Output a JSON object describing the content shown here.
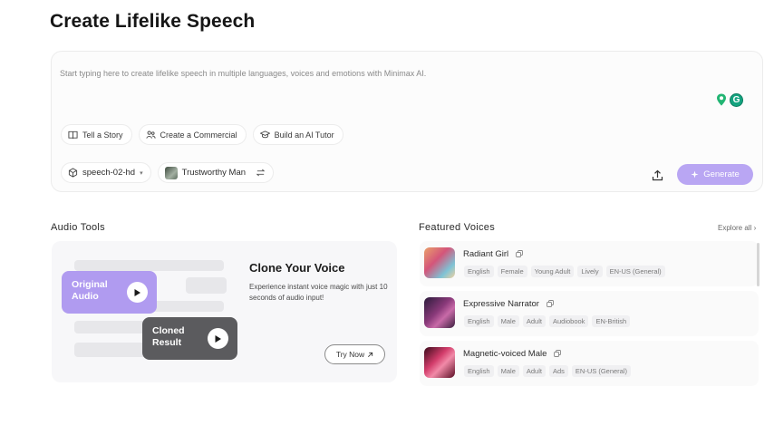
{
  "page": {
    "title": "Create Lifelike Speech"
  },
  "editor": {
    "placeholder": "Start typing here to create lifelike speech in multiple languages, voices and emotions with Minimax AI.",
    "chips": [
      {
        "label": "Tell a Story",
        "icon": "book-icon"
      },
      {
        "label": "Create a Commercial",
        "icon": "people-icon"
      },
      {
        "label": "Build an AI Tutor",
        "icon": "graduation-cap-icon"
      }
    ],
    "model": {
      "label": "speech-02-hd",
      "icon": "cube-icon"
    },
    "voice": {
      "label": "Trustworthy Man"
    },
    "generate_label": "Generate"
  },
  "audio_tools": {
    "title": "Audio Tools",
    "original_label": "Original Audio",
    "cloned_label": "Cloned Result",
    "clone_title": "Clone Your Voice",
    "clone_desc": "Experience instant voice magic with just 10 seconds of audio input!",
    "try_label": "Try Now"
  },
  "featured": {
    "title": "Featured Voices",
    "explore_label": "Explore all",
    "voices": [
      {
        "name": "Radiant Girl",
        "tags": [
          "English",
          "Female",
          "Young Adult",
          "Lively",
          "EN-US (General)"
        ]
      },
      {
        "name": "Expressive Narrator",
        "tags": [
          "English",
          "Male",
          "Adult",
          "Audiobook",
          "EN-British"
        ]
      },
      {
        "name": "Magnetic-voiced Male",
        "tags": [
          "English",
          "Male",
          "Adult",
          "Ads",
          "EN-US (General)"
        ]
      }
    ]
  },
  "colors": {
    "accent": "#b9a6f3",
    "original_card": "#b09bf0",
    "cloned_card": "#5b5b5e",
    "grammar": "#14a37f"
  }
}
